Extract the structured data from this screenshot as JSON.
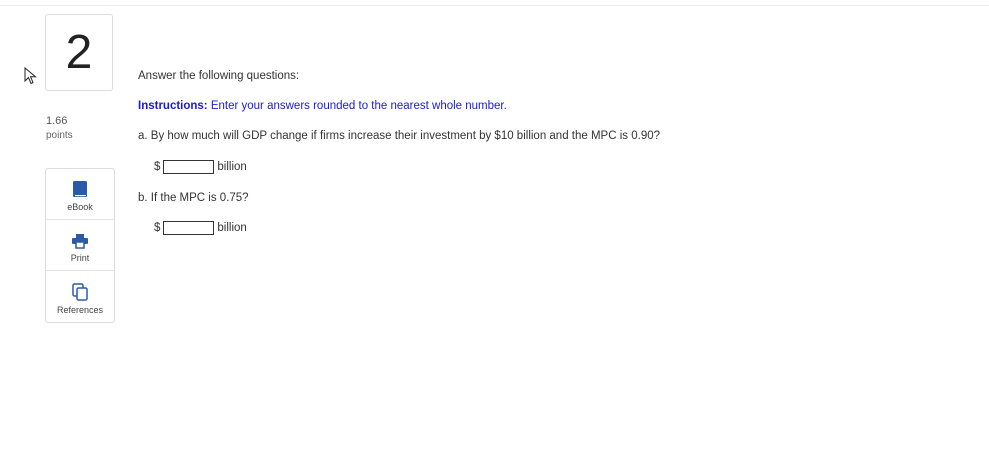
{
  "question": {
    "number": "2",
    "points_value": "1.66",
    "points_label": "points"
  },
  "tools": [
    {
      "label": "eBook",
      "icon": "book-icon"
    },
    {
      "label": "Print",
      "icon": "printer-icon"
    },
    {
      "label": "References",
      "icon": "references-icon"
    }
  ],
  "content": {
    "intro": "Answer the following questions:",
    "instructions_label": "Instructions:",
    "instructions_text": " Enter your answers rounded to the nearest whole number.",
    "part_a": {
      "prompt": "a. By how much will GDP change if firms increase their investment by $10 billion and the MPC is 0.90?",
      "currency": "$",
      "value": "",
      "unit": "billion"
    },
    "part_b": {
      "prompt": "b. If the MPC is 0.75?",
      "currency": "$",
      "value": "",
      "unit": "billion"
    }
  },
  "colors": {
    "instructions": "#1a1ad6",
    "icon_blue": "#2b5aa8",
    "border": "#dddddd"
  }
}
